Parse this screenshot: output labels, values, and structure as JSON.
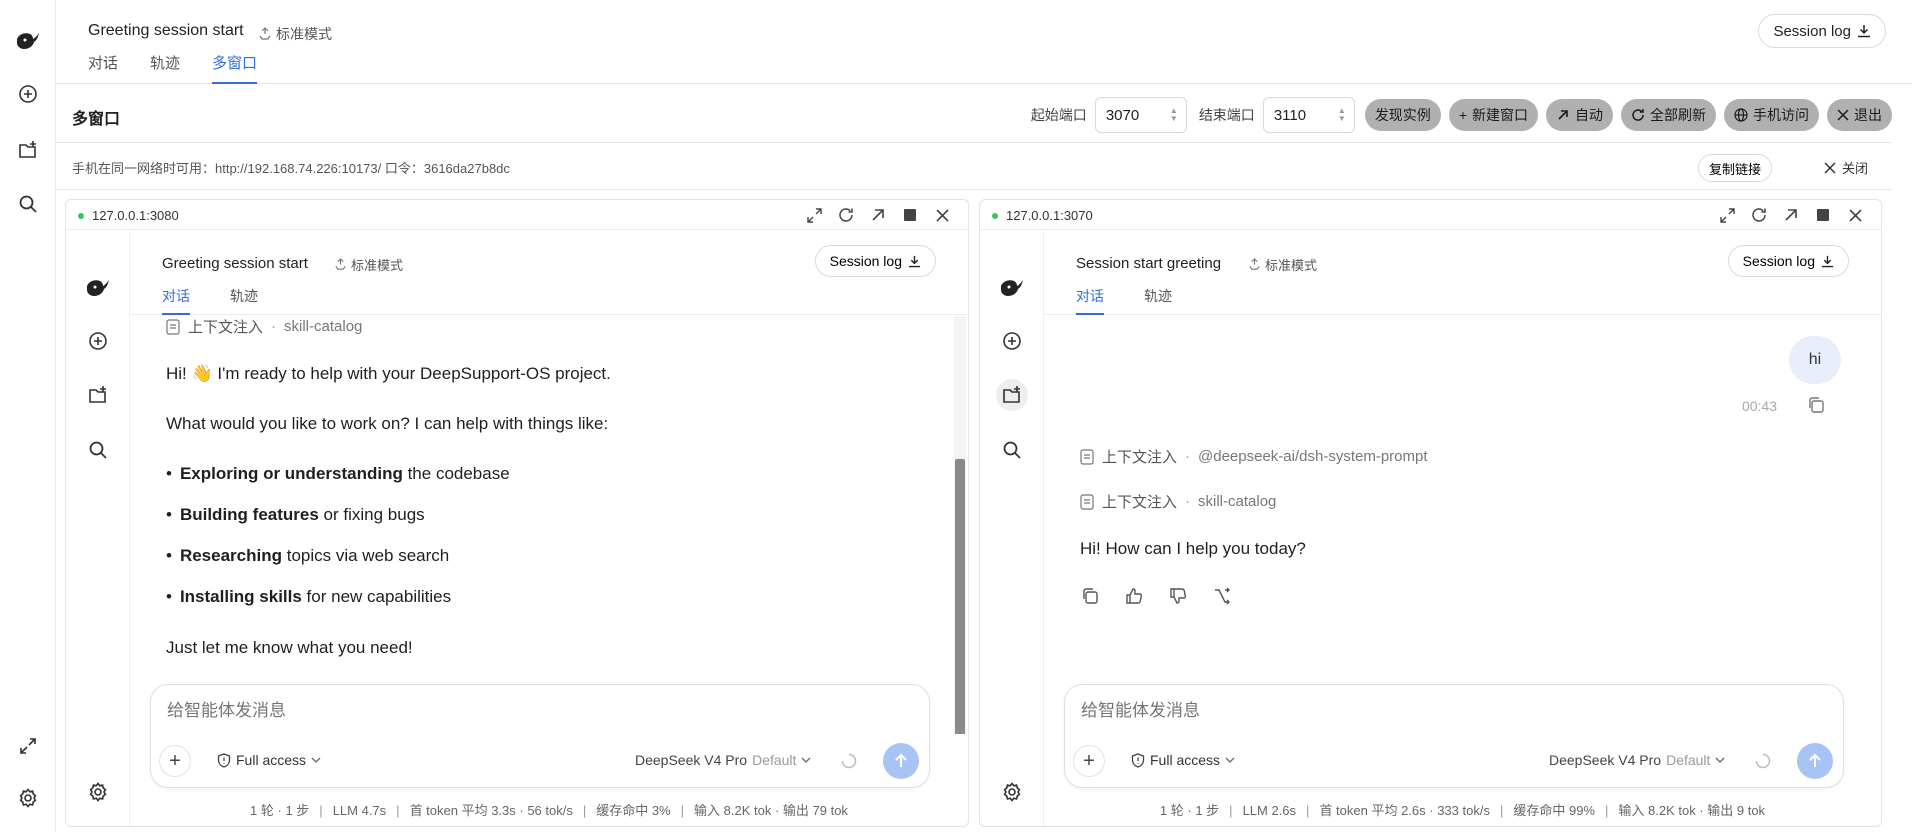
{
  "header": {
    "title": "Greeting session start",
    "mode": "标准模式",
    "tabs": [
      "对话",
      "轨迹",
      "多窗口"
    ],
    "session_log": "Session log"
  },
  "toolbar": {
    "title": "多窗口",
    "start_port_label": "起始端口",
    "start_port": "3070",
    "end_port_label": "结束端口",
    "end_port": "3110",
    "buttons": [
      "发现实例",
      "新建窗口",
      "自动",
      "全部刷新",
      "手机访问",
      "退出"
    ]
  },
  "info": {
    "text": "手机在同一网络时可用：http://192.168.74.226:10173/ 口令：3616da27b8dc",
    "copy": "复制链接",
    "close": "关闭"
  },
  "panes": [
    {
      "url": "127.0.0.1:3080",
      "title": "Greeting session start",
      "mode": "标准模式",
      "tabs": [
        "对话",
        "轨迹"
      ],
      "session_log": "Session log",
      "context": [
        {
          "label": "上下文注入",
          "value": "skill-catalog"
        }
      ],
      "intro": "Hi! 👋 I'm ready to help with your DeepSupport-OS project.",
      "question": "What would you like to work on? I can help with things like:",
      "bullets": [
        {
          "bold": "Exploring or understanding",
          "rest": " the codebase"
        },
        {
          "bold": "Building features",
          "rest": " or fixing bugs"
        },
        {
          "bold": "Researching",
          "rest": " topics via web search"
        },
        {
          "bold": "Installing skills",
          "rest": " for new capabilities"
        }
      ],
      "closing": "Just let me know what you need!",
      "placeholder": "给智能体发消息",
      "access": "Full access",
      "model": "DeepSeek V4 Pro",
      "model_default": "Default",
      "stats": [
        "1 轮 · 1 步",
        "LLM 4.7s",
        "首 token 平均 3.3s · 56 tok/s",
        "缓存命中 3%",
        "输入 8.2K tok · 输出 79 tok"
      ]
    },
    {
      "url": "127.0.0.1:3070",
      "title": "Session start greeting",
      "mode": "标准模式",
      "tabs": [
        "对话",
        "轨迹"
      ],
      "session_log": "Session log",
      "user_message": "hi",
      "timestamp": "00:43",
      "context": [
        {
          "label": "上下文注入",
          "value": "@deepseek-ai/dsh-system-prompt"
        },
        {
          "label": "上下文注入",
          "value": "skill-catalog"
        }
      ],
      "reply": "Hi! How can I help you today?",
      "placeholder": "给智能体发消息",
      "access": "Full access",
      "model": "DeepSeek V4 Pro",
      "model_default": "Default",
      "stats": [
        "1 轮 · 1 步",
        "LLM 2.6s",
        "首 token 平均 2.6s · 333 tok/s",
        "缓存命中 99%",
        "输入 8.2K tok · 输出 9 tok"
      ]
    }
  ],
  "icons": [
    "whale-logo-icon",
    "new-chat-icon",
    "new-folder-icon",
    "search-icon",
    "expand-icon",
    "settings-icon"
  ],
  "colors": {
    "accent": "#2f6fdd",
    "status_dot": "#3cc462",
    "button_gray": "#b0b0b0",
    "send_button": "#a7c4f5"
  }
}
